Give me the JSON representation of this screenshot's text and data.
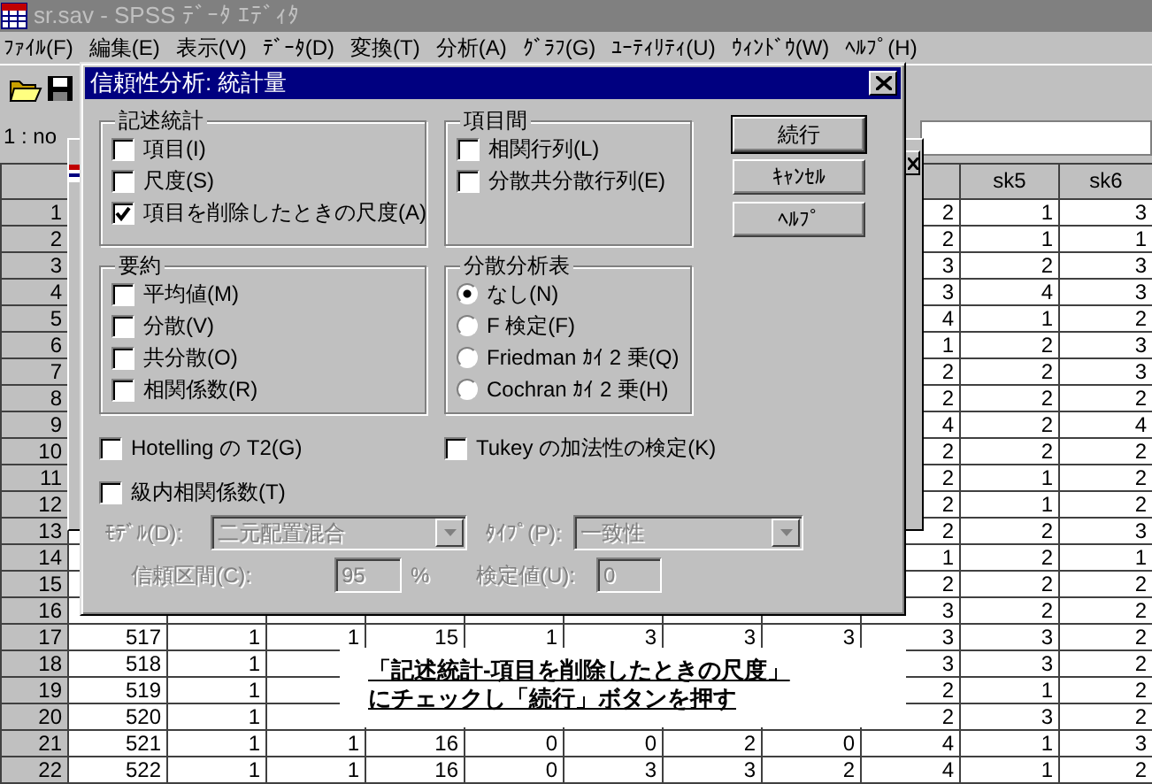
{
  "app_window": {
    "title": "sr.sav - SPSS ﾃﾞｰﾀ ｴﾃﾞｨﾀ"
  },
  "menu": [
    "ﾌｧｲﾙ(F)",
    "編集(E)",
    "表示(V)",
    "ﾃﾞｰﾀ(D)",
    "変換(T)",
    "分析(A)",
    "ｸﾞﾗﾌ(G)",
    "ﾕｰﾃｨﾘﾃｨ(U)",
    "ｳｨﾝﾄﾞｳ(W)",
    "ﾍﾙﾌﾟ(H)"
  ],
  "cell_reference": "1 : no",
  "grid": {
    "column_headers": [
      "sk5",
      "sk6"
    ],
    "rows": [
      {
        "number": "1",
        "cells": [
          null,
          null,
          null,
          null,
          null,
          null,
          null,
          null,
          "2",
          "1",
          "3"
        ]
      },
      {
        "number": "2",
        "cells": [
          null,
          null,
          null,
          null,
          null,
          null,
          null,
          null,
          "2",
          "1",
          "1"
        ]
      },
      {
        "number": "3",
        "cells": [
          null,
          null,
          null,
          null,
          null,
          null,
          null,
          null,
          "3",
          "2",
          "3"
        ]
      },
      {
        "number": "4",
        "cells": [
          null,
          null,
          null,
          null,
          null,
          null,
          null,
          null,
          "3",
          "4",
          "3"
        ]
      },
      {
        "number": "5",
        "cells": [
          null,
          null,
          null,
          null,
          null,
          null,
          null,
          null,
          "4",
          "1",
          "2"
        ]
      },
      {
        "number": "6",
        "cells": [
          null,
          null,
          null,
          null,
          null,
          null,
          null,
          null,
          "1",
          "2",
          "3"
        ]
      },
      {
        "number": "7",
        "cells": [
          null,
          null,
          null,
          null,
          null,
          null,
          null,
          null,
          "2",
          "2",
          "3"
        ]
      },
      {
        "number": "8",
        "cells": [
          null,
          null,
          null,
          null,
          null,
          null,
          null,
          null,
          "2",
          "2",
          "2"
        ]
      },
      {
        "number": "9",
        "cells": [
          null,
          null,
          null,
          null,
          null,
          null,
          null,
          null,
          "4",
          "2",
          "4"
        ]
      },
      {
        "number": "10",
        "cells": [
          null,
          null,
          null,
          null,
          null,
          null,
          null,
          null,
          "2",
          "2",
          "2"
        ]
      },
      {
        "number": "11",
        "cells": [
          null,
          null,
          null,
          null,
          null,
          null,
          null,
          null,
          "2",
          "1",
          "2"
        ]
      },
      {
        "number": "12",
        "cells": [
          null,
          null,
          null,
          null,
          null,
          null,
          null,
          null,
          "2",
          "1",
          "2"
        ]
      },
      {
        "number": "13",
        "cells": [
          null,
          null,
          null,
          null,
          null,
          null,
          null,
          null,
          "2",
          "2",
          "3"
        ]
      },
      {
        "number": "14",
        "cells": [
          null,
          null,
          null,
          null,
          null,
          null,
          null,
          null,
          "1",
          "2",
          "1"
        ]
      },
      {
        "number": "15",
        "cells": [
          null,
          null,
          null,
          null,
          null,
          null,
          null,
          null,
          "2",
          "2",
          "2"
        ]
      },
      {
        "number": "16",
        "cells": [
          null,
          null,
          null,
          null,
          null,
          null,
          null,
          null,
          "3",
          "2",
          "2"
        ]
      },
      {
        "number": "17",
        "cells": [
          "517",
          "1",
          "1",
          "15",
          "1",
          "3",
          "3",
          "3",
          "3",
          "3",
          "2"
        ]
      },
      {
        "number": "18",
        "cells": [
          "518",
          "1",
          null,
          null,
          null,
          null,
          null,
          null,
          "3",
          "3",
          "2"
        ]
      },
      {
        "number": "19",
        "cells": [
          "519",
          "1",
          null,
          null,
          null,
          null,
          null,
          null,
          "2",
          "1",
          "2"
        ]
      },
      {
        "number": "20",
        "cells": [
          "520",
          "1",
          null,
          null,
          null,
          null,
          null,
          null,
          "2",
          "3",
          "2"
        ]
      },
      {
        "number": "21",
        "cells": [
          "521",
          "1",
          "1",
          "16",
          "0",
          "0",
          "2",
          "0",
          "4",
          "1",
          "3"
        ]
      },
      {
        "number": "22",
        "cells": [
          "522",
          "1",
          "1",
          "16",
          "0",
          "3",
          "3",
          "2",
          "4",
          "1",
          "2"
        ]
      }
    ]
  },
  "dialog": {
    "title": "信頼性分析: 統計量",
    "groups": [
      {
        "title": "記述統計",
        "items": [
          {
            "kind": "checkbox",
            "label": "項目(I)",
            "checked": false
          },
          {
            "kind": "checkbox",
            "label": "尺度(S)",
            "checked": false
          },
          {
            "kind": "checkbox",
            "label": "項目を削除したときの尺度(A)",
            "checked": true
          }
        ]
      },
      {
        "title": "項目間",
        "items": [
          {
            "kind": "checkbox",
            "label": "相関行列(L)",
            "checked": false
          },
          {
            "kind": "checkbox",
            "label": "分散共分散行列(E)",
            "checked": false
          }
        ]
      },
      {
        "title": "要約",
        "items": [
          {
            "kind": "checkbox",
            "label": "平均値(M)",
            "checked": false
          },
          {
            "kind": "checkbox",
            "label": "分散(V)",
            "checked": false
          },
          {
            "kind": "checkbox",
            "label": "共分散(O)",
            "checked": false
          },
          {
            "kind": "checkbox",
            "label": "相関係数(R)",
            "checked": false
          }
        ]
      },
      {
        "title": "分散分析表",
        "items": [
          {
            "kind": "radio",
            "label": "なし(N)",
            "selected": true
          },
          {
            "kind": "radio",
            "label": "F 検定(F)",
            "selected": false
          },
          {
            "kind": "radio",
            "label": "Friedman ｶｲ 2 乗(Q)",
            "selected": false
          },
          {
            "kind": "radio",
            "label": "Cochran ｶｲ 2 乗(H)",
            "selected": false
          }
        ]
      }
    ],
    "buttons": [
      {
        "label": "続行",
        "default": true
      },
      {
        "label": "ｷｬﾝｾﾙ",
        "default": false
      },
      {
        "label": "ﾍﾙﾌﾟ",
        "default": false
      }
    ],
    "options": [
      {
        "kind": "checkbox",
        "label": "Hotelling の T2(G)",
        "checked": false
      },
      {
        "kind": "checkbox",
        "label": "Tukey の加法性の検定(K)",
        "checked": false
      }
    ],
    "icc": {
      "kind": "checkbox",
      "label": "級内相関係数(T)",
      "checked": false
    },
    "field_rows": [
      [
        {
          "label": "ﾓﾃﾞﾙ(D):",
          "kind": "select",
          "value": "二元配置混合",
          "disabled": true
        },
        {
          "label": "ﾀｲﾌﾟ(P):",
          "kind": "select",
          "value": "一致性",
          "disabled": true
        }
      ],
      [
        {
          "label": "信頼区間(C):",
          "kind": "number",
          "value": "95",
          "unit": "%",
          "disabled": true
        },
        {
          "label": "検定値(U):",
          "kind": "number",
          "value": "0",
          "disabled": true
        }
      ]
    ]
  },
  "annotation": {
    "lines": [
      "「記述統計-項目を削除したときの尺度」",
      "にチェックし「続行」ボタンを押す"
    ]
  }
}
